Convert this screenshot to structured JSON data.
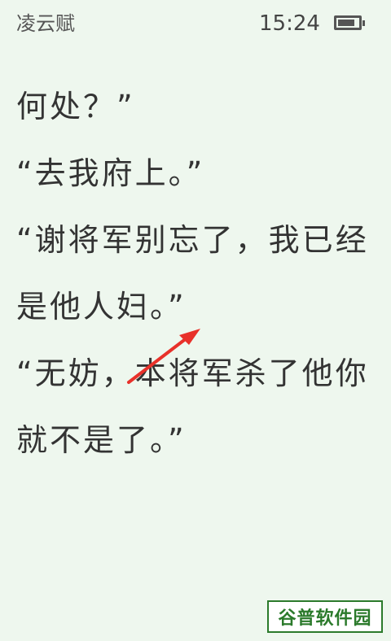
{
  "status_bar": {
    "book_title": "凌云赋",
    "time": "15:24",
    "battery_level": 0.85
  },
  "reader": {
    "lines": [
      "何处？”",
      "“去我府上。”",
      "“谢将军别忘了，我已经",
      "是他人妇。”",
      "“无妨，本将军杀了他你",
      "就不是了。”"
    ]
  },
  "annotation": {
    "arrow_color": "#e8312a"
  },
  "watermark": {
    "text": "谷普软件园"
  }
}
